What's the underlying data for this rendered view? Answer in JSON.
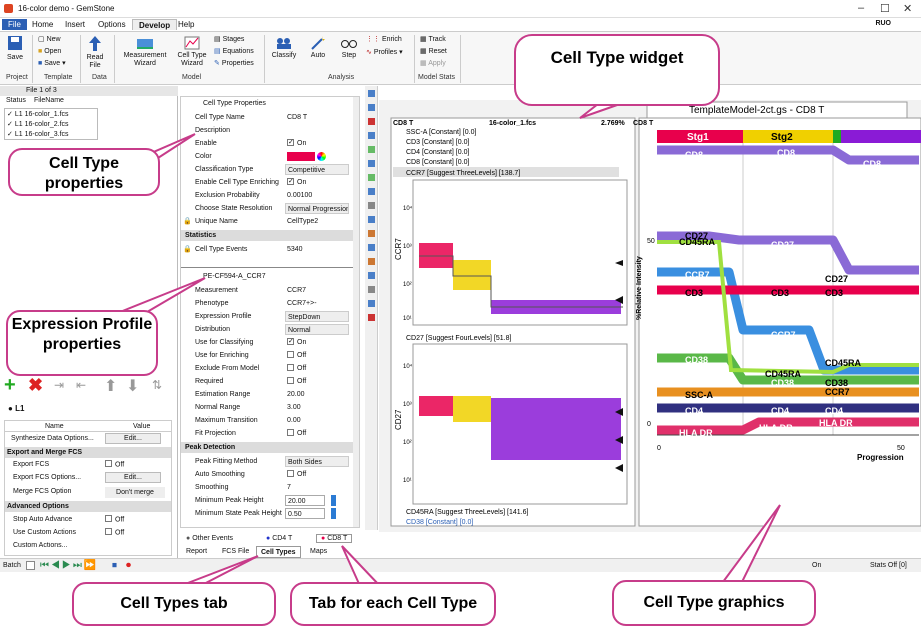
{
  "window": {
    "title": "16-color demo - GemStone",
    "ruo": "RUO"
  },
  "menu": [
    "File",
    "Home",
    "Insert",
    "Options",
    "Develop",
    "Help"
  ],
  "ribbon": {
    "save": "Save",
    "new": "New",
    "open": "Open",
    "save2": "Save",
    "read_file": "Read File",
    "measurement_wizard": "Measurement Wizard",
    "cell_type_wizard": "Cell Type Wizard",
    "stages": "Stages",
    "equations": "Equations",
    "properties": "Properties",
    "classify": "Classify",
    "auto": "Auto",
    "step": "Step",
    "enrich": "Enrich",
    "profiles": "Profiles",
    "track": "Track",
    "reset": "Reset",
    "apply": "Apply",
    "groups": [
      "Project",
      "Template",
      "Data",
      "Model",
      "Analysis",
      "Model Stats"
    ]
  },
  "files": {
    "counter": "File 1 of 3",
    "col_status": "Status",
    "col_filename": "FileName",
    "rows": [
      {
        "status": "L1",
        "name": "16-color_1.fcs"
      },
      {
        "status": "L1",
        "name": "16-color_2.fcs"
      },
      {
        "status": "L1",
        "name": "16-color_3.fcs"
      }
    ]
  },
  "level": "L1",
  "options": {
    "col_name": "Name",
    "col_value": "Value",
    "synth": "Synthesize Data Options...",
    "edit": "Edit...",
    "export_hdr": "Export and Merge FCS",
    "export_fcs": "Export FCS",
    "off": "Off",
    "export_opts": "Export FCS Options...",
    "merge": "Merge FCS Option",
    "dont_merge": "Don't merge",
    "adv_hdr": "Advanced Options",
    "stop_auto": "Stop Auto Advance",
    "custom_actions": "Use Custom Actions",
    "custom_actions2": "Custom Actions..."
  },
  "celltype_props": {
    "title": "Cell Type Properties",
    "name_k": "Cell Type Name",
    "name_v": "CD8 T",
    "desc_k": "Description",
    "enable_k": "Enable",
    "on": "On",
    "color_k": "Color",
    "class_k": "Classification Type",
    "class_v": "Competitive",
    "enrich_k": "Enable Cell Type Enriching",
    "excl_k": "Exclusion Probability",
    "excl_v": "0.00100",
    "state_k": "Choose State Resolution",
    "state_v": "Normal Progression (1",
    "uniq_k": "Unique Name",
    "uniq_v": "CellType2",
    "stats_hdr": "Statistics",
    "events_k": "Cell Type Events",
    "events_v": "5340"
  },
  "expr_props": {
    "title": "PE-CF594-A_CCR7",
    "meas_k": "Measurement",
    "meas_v": "CCR7",
    "pheno_k": "Phenotype",
    "pheno_v": "CCR7+>-",
    "profile_k": "Expression Profile",
    "profile_v": "StepDown",
    "dist_k": "Distribution",
    "dist_v": "Normal",
    "useclass_k": "Use for Classifying",
    "on": "On",
    "off": "Off",
    "useenrich_k": "Use for Enriching",
    "exclmodel_k": "Exclude From Model",
    "req_k": "Required",
    "est_k": "Estimation Range",
    "est_v": "20.00",
    "norm_k": "Normal Range",
    "norm_v": "3.00",
    "maxtr_k": "Maximum Transition",
    "maxtr_v": "0.00",
    "fit_k": "Fit Projection",
    "peak_hdr": "Peak Detection",
    "pfm_k": "Peak Fitting Method",
    "pfm_v": "Both Sides",
    "auto_k": "Auto Smoothing",
    "smooth_k": "Smoothing",
    "smooth_v": "7",
    "minpk_k": "Minimum Peak Height",
    "minpk_v": "20.00",
    "minst_k": "Minimum State Peak Height",
    "minst_v": "0.50"
  },
  "plots": {
    "title_left": "CD8 T",
    "file": "16-color_1.fcs",
    "pct": "2.769%",
    "list1": [
      "SSC-A [Constant] [0.0]",
      "CD3 [Constant] [0.0]",
      "CD4 [Constant] [0.0]",
      "CD8 [Constant] [0.0]"
    ],
    "ccr7": "CCR7 [Suggest ThreeLevels] [138.7]",
    "cd27": "CD27 [Suggest FourLevels] [51.8]",
    "cd45ra": "CD45RA [Suggest ThreeLevels] [141.6]",
    "cd38": "CD38 [Constant] [0.0]",
    "ylab1": "CCR7",
    "ylab2": "CD27",
    "ticks_log": [
      "10⁴",
      "10³",
      "10²",
      "10¹",
      "10⁰"
    ],
    "ticks_log2": [
      "10⁴",
      "10³",
      "10²",
      "10¹",
      "10⁰"
    ],
    "model_title": "TemplateModel-2ct.gs - CD8 T",
    "model_label": "CD8 T",
    "stages": [
      "Stg1",
      "Stg2"
    ],
    "ylabel_r": "%Relative Intensity",
    "xlabel_r": "Progression",
    "yt": [
      "50",
      "0"
    ],
    "xt": [
      "0",
      "50"
    ],
    "band_labels": [
      "CD8",
      "CD8",
      "CD8",
      "CD27",
      "CD45RA",
      "CD27",
      "CCR7",
      "CD27",
      "CD3",
      "CD3",
      "CD3",
      "CCR7",
      "CD38",
      "CD45RA",
      "CD38",
      "CD38",
      "SSC-A",
      "CCR7",
      "CD4",
      "CD4",
      "CD4",
      "HLA DR",
      "HLA DR",
      "HLA DR",
      "CD45RA"
    ]
  },
  "tabs_ct": {
    "other": "Other Events",
    "cd4": "CD4 T",
    "cd8": "CD8 T"
  },
  "tabs": {
    "report": "Report",
    "fcs": "FCS File",
    "celltypes": "Cell Types",
    "maps": "Maps"
  },
  "status": {
    "batch": "Batch",
    "on": "On",
    "stats": "Stats Off [0]"
  },
  "callouts": {
    "widget": "Cell Type widget",
    "ctprops": "Cell Type properties",
    "expr": "Expression Profile properties",
    "cttab": "Cell Types tab",
    "eachtab": "Tab for each Cell Type",
    "graphics": "Cell Type graphics"
  },
  "colors": {
    "accent": "#2b5fb4",
    "callout": "#c73c8a",
    "cd8": "#e8004c"
  }
}
